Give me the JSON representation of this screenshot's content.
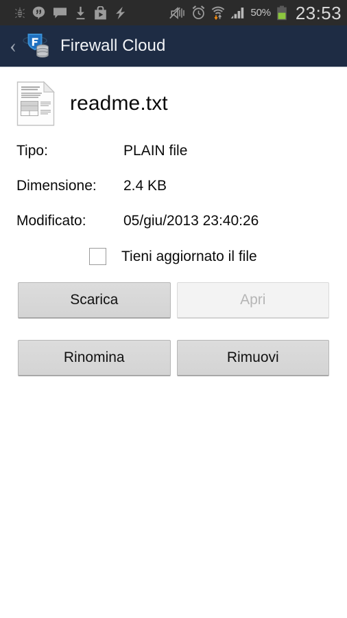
{
  "status_bar": {
    "icons_left": [
      "bug-icon",
      "hangouts-icon",
      "message-icon",
      "download-icon",
      "play-store-icon",
      "lightning-icon"
    ],
    "icons_right": [
      "mute-icon",
      "alarm-icon",
      "wifi-icon",
      "signal-icon"
    ],
    "battery_percent": "50%",
    "battery_icon": "battery-icon",
    "battery_color": "#8cc63e",
    "clock": "23:53"
  },
  "action_bar": {
    "back_label": "‹",
    "app_icon": "firewall-cloud-icon",
    "title": "Firewall Cloud",
    "background_color": "#1e2c44"
  },
  "file": {
    "icon": "plain-file-icon",
    "name": "readme.txt",
    "details": [
      {
        "label": "Tipo:",
        "value": "PLAIN file"
      },
      {
        "label": "Dimensione:",
        "value": "2.4 KB"
      },
      {
        "label": "Modificato:",
        "value": "05/giu/2013 23:40:26"
      }
    ]
  },
  "keep_updated": {
    "label": "Tieni aggiornato il file",
    "checked": false
  },
  "buttons": [
    {
      "label": "Scarica",
      "enabled": true
    },
    {
      "label": "Apri",
      "enabled": false
    },
    {
      "label": "Rinomina",
      "enabled": true
    },
    {
      "label": "Rimuovi",
      "enabled": true
    }
  ]
}
